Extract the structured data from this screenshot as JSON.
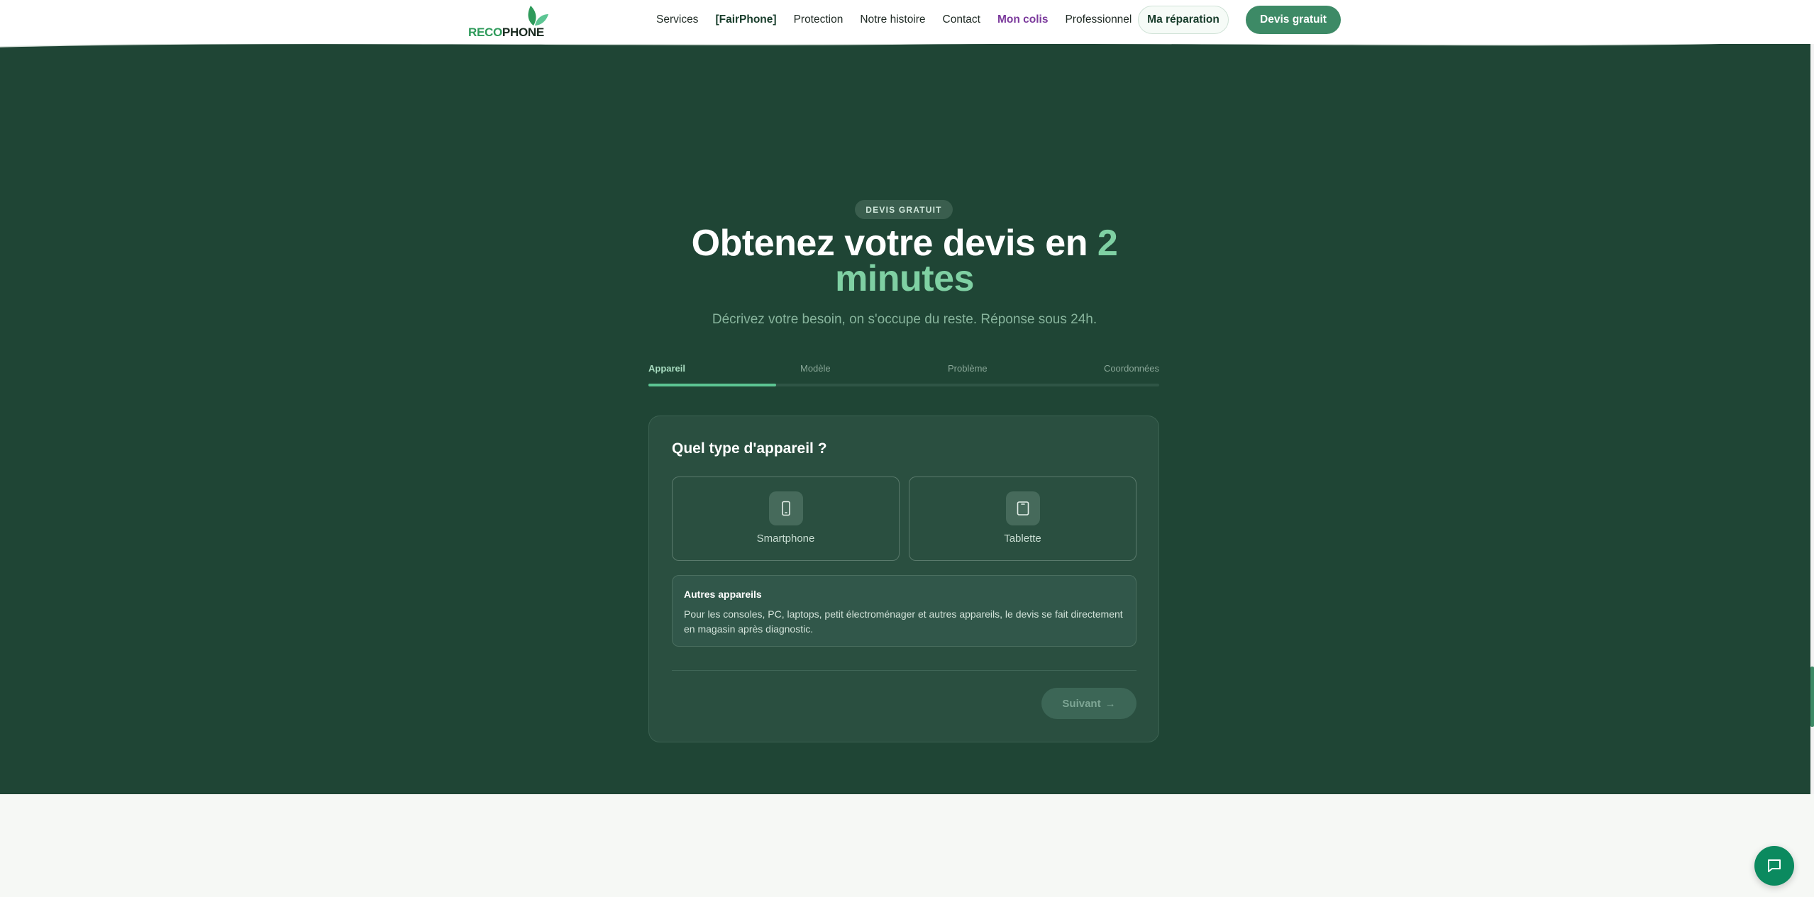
{
  "header": {
    "logo": {
      "part1": "RECO",
      "part2": "PHONE"
    },
    "nav": [
      {
        "label": "Services",
        "style": "normal"
      },
      {
        "label": "[FairPhone]",
        "style": "bold"
      },
      {
        "label": "Protection",
        "style": "normal"
      },
      {
        "label": "Notre histoire",
        "style": "normal"
      },
      {
        "label": "Contact",
        "style": "normal"
      },
      {
        "label": "Mon colis",
        "style": "purple"
      },
      {
        "label": "Professionnel",
        "style": "normal"
      }
    ],
    "repair_button": "Ma réparation",
    "quote_button": "Devis gratuit"
  },
  "hero": {
    "badge": "DEVIS GRATUIT",
    "title_main": "Obtenez votre devis en ",
    "title_accent": "2 minutes",
    "subtitle": "Décrivez votre besoin, on s'occupe du reste. Réponse sous 24h."
  },
  "steps": {
    "items": [
      "Appareil",
      "Modèle",
      "Problème",
      "Coordonnées"
    ],
    "active_index": 0,
    "progress": 0.25
  },
  "form": {
    "question": "Quel type d'appareil ?",
    "options": [
      {
        "label": "Smartphone",
        "icon": "smartphone-icon"
      },
      {
        "label": "Tablette",
        "icon": "tablet-icon"
      }
    ],
    "other": {
      "title": "Autres appareils",
      "text": "Pour les consoles, PC, laptops, petit électroménager et autres appareils, le devis se fait directement en magasin après diagnostic."
    },
    "next_button": "Suivant",
    "next_arrow": "→"
  },
  "colors": {
    "hero_bg": "#1f4535",
    "accent": "#7fd0a3",
    "brand_green": "#3d8a66",
    "nav_purple": "#7b3a9c",
    "chat_button": "#0b8a5f"
  },
  "chat": {
    "icon": "chat-bubble-icon"
  }
}
